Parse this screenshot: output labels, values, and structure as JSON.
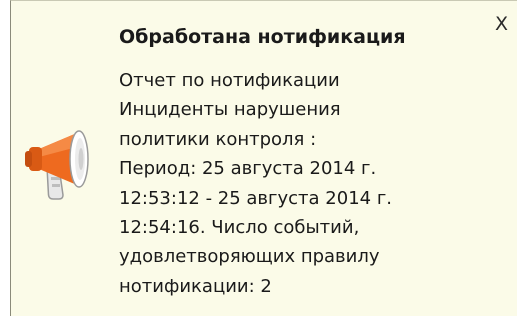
{
  "notification": {
    "title": "Обработана нотификация",
    "close_label": "X",
    "icon": "megaphone-icon",
    "accent_color": "#ee6a1f",
    "message_lines": [
      "Отчет по нотификации",
      "Инциденты нарушения",
      "политики контроля :",
      "Период: 25 августа 2014 г.",
      "12:53:12 - 25 августа 2014 г.",
      "12:54:16. Число событий,",
      "удовлетворяющих правилу",
      "нотификации: 2"
    ]
  }
}
